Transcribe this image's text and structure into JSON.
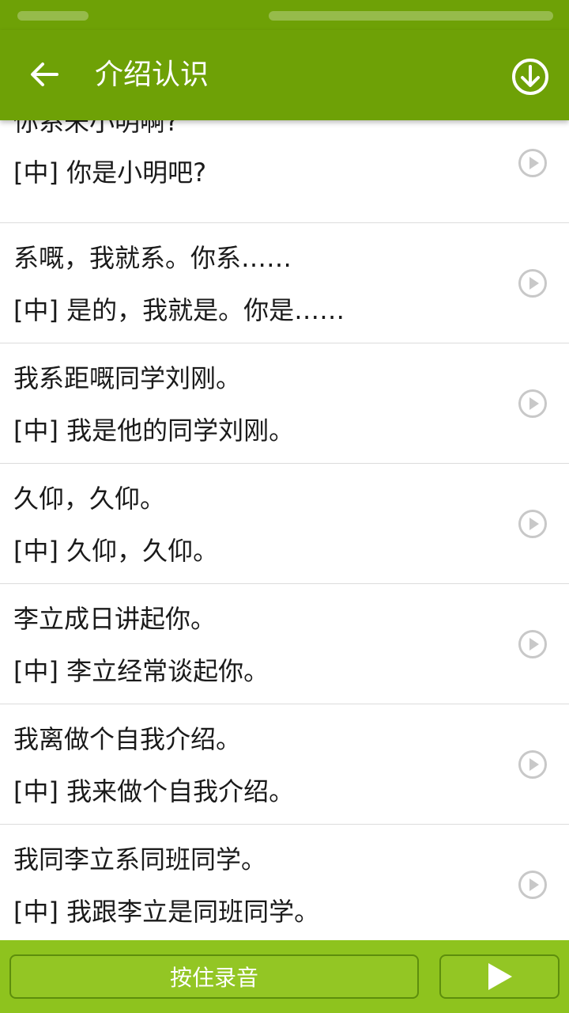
{
  "header": {
    "title": "介绍认识",
    "back_icon": "arrow-left-icon",
    "download_icon": "download-circle-icon"
  },
  "colors": {
    "primary": "#6ea106",
    "bottom_bar": "#8ec31e",
    "button_border": "#5d8e0c",
    "divider": "#dcdcdc",
    "play_icon": "#c8c8c8"
  },
  "phrases": [
    {
      "cantonese": "你系未小明啊?",
      "mandarin": "[中] 你是小明吧?"
    },
    {
      "cantonese": "系嘅，我就系。你系……",
      "mandarin": "[中] 是的，我就是。你是……"
    },
    {
      "cantonese": "我系距嘅同学刘刚。",
      "mandarin": "[中] 我是他的同学刘刚。"
    },
    {
      "cantonese": "久仰，久仰。",
      "mandarin": "[中] 久仰，久仰。"
    },
    {
      "cantonese": "李立成日讲起你。",
      "mandarin": "[中] 李立经常谈起你。"
    },
    {
      "cantonese": "我离做个自我介绍。",
      "mandarin": "[中] 我来做个自我介绍。"
    },
    {
      "cantonese": "我同李立系同班同学。",
      "mandarin": "[中] 我跟李立是同班同学。"
    }
  ],
  "bottom": {
    "record_label": "按住录音",
    "play_icon": "play-triangle-icon"
  }
}
